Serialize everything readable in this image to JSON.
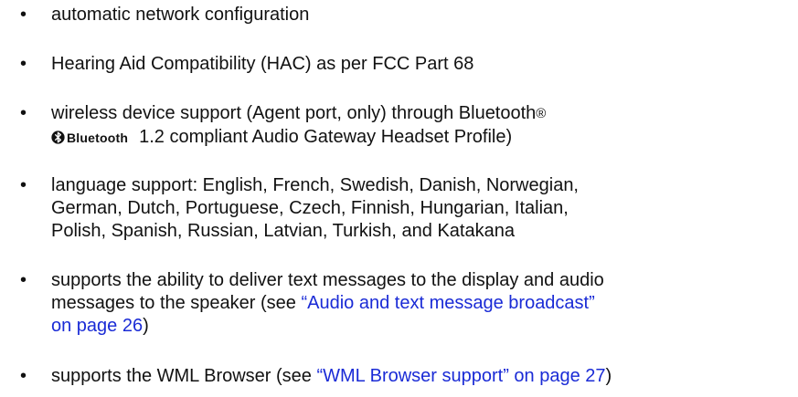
{
  "bullet_glyph": "•",
  "items": [
    {
      "lines": [
        "automatic network configuration"
      ]
    },
    {
      "lines": [
        "Hearing Aid Compatibility (HAC) as per FCC Part 68"
      ]
    },
    {
      "line1": "wireless device support (Agent port, only) through Bluetooth",
      "reg_mark": "®",
      "logo_text": "Bluetooth",
      "line2_rest": "1.2 compliant Audio Gateway Headset Profile)"
    },
    {
      "lines": [
        "language support: English, French, Swedish, Danish, Norwegian,",
        "German, Dutch, Portuguese, Czech, Finnish, Hungarian, Italian,",
        "Polish, Spanish, Russian, Latvian, Turkish, and Katakana"
      ]
    },
    {
      "line1": "supports the ability to deliver text messages to the display and audio",
      "line2_text": "messages to the speaker (see ",
      "line2_link": "“Audio and text message broadcast”",
      "line3_link": "on page 26",
      "line3_text": ")"
    },
    {
      "text": "supports the WML Browser (see ",
      "link": "“WML Browser support” on page 27",
      "text_after": ")"
    }
  ],
  "colors": {
    "text": "#111111",
    "link": "#1a2bd6"
  },
  "icons": {
    "bluetooth_logo": "bluetooth-logo-icon"
  }
}
